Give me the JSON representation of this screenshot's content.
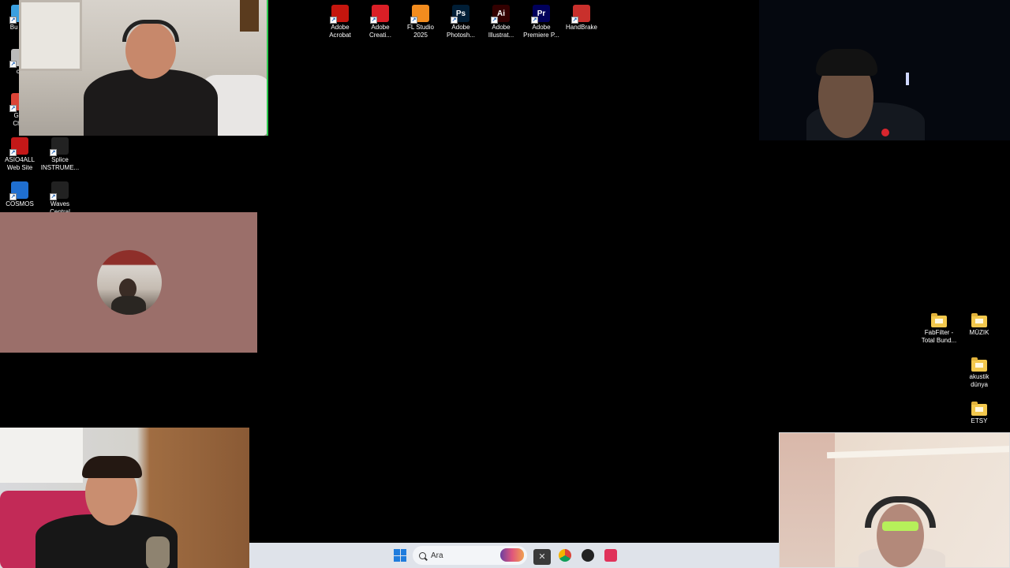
{
  "desktop_left": [
    {
      "label": "Bu bilg",
      "icon": "pc-icon",
      "color": "#3aa0e0"
    },
    {
      "label": "cp",
      "icon": "gear-icon",
      "color": "#bbbbbb"
    },
    {
      "label": "Goo\nChro",
      "icon": "chrome-icon",
      "color": "#db4437"
    },
    {
      "label": "ASIO4ALL\nWeb Site",
      "icon": "asio-icon",
      "color": "#c41818"
    },
    {
      "label": "Splice\nINSTRUME...",
      "icon": "splice-icon",
      "color": "#222222"
    },
    {
      "label": "COSMOS",
      "icon": "cosmos-icon",
      "color": "#1f6fd0"
    },
    {
      "label": "Waves\nCentral",
      "icon": "waves-icon",
      "color": "#222222"
    }
  ],
  "desktop_top": [
    {
      "label": "Adobe\nAcrobat",
      "icon": "acrobat-icon",
      "color": "#c5160e",
      "glyph": ""
    },
    {
      "label": "Adobe\nCreati...",
      "icon": "creative-cloud-icon",
      "color": "#da1f26",
      "glyph": ""
    },
    {
      "label": "FL Studio\n2025",
      "icon": "fl-studio-icon",
      "color": "#f28c1e",
      "glyph": ""
    },
    {
      "label": "Adobe\nPhotosh...",
      "icon": "photoshop-icon",
      "color": "#001e36",
      "glyph": "Ps"
    },
    {
      "label": "Adobe\nIllustrat...",
      "icon": "illustrator-icon",
      "color": "#330000",
      "glyph": "Ai"
    },
    {
      "label": "Adobe\nPremiere P...",
      "icon": "premiere-icon",
      "color": "#00005b",
      "glyph": "Pr"
    },
    {
      "label": "HandBrake",
      "icon": "handbrake-icon",
      "color": "#c9302c",
      "glyph": ""
    }
  ],
  "desktop_right": [
    {
      "label": "FabFilter -\nTotal Bund...",
      "icon": "folder-icon"
    },
    {
      "label": "MÜZIK",
      "icon": "folder-icon"
    },
    {
      "label": "akustik\ndünya",
      "icon": "folder-icon"
    },
    {
      "label": "ETSY",
      "icon": "folder-icon"
    }
  ],
  "taskbar": {
    "search_placeholder": "Ara",
    "apps": [
      {
        "icon": "task-view-icon",
        "color": "#444444"
      },
      {
        "icon": "chrome-icon",
        "color": "#db4437"
      },
      {
        "icon": "obs-icon",
        "color": "#222222"
      },
      {
        "icon": "app-red-icon",
        "color": "#e0325a"
      }
    ]
  },
  "video_tiles": [
    "participant-1",
    "participant-2",
    "participant-3",
    "participant-4",
    "participant-5"
  ],
  "colors": {
    "active_speaker_border": "#2cc84d",
    "taskbar_bg": "#dfe3ea"
  }
}
